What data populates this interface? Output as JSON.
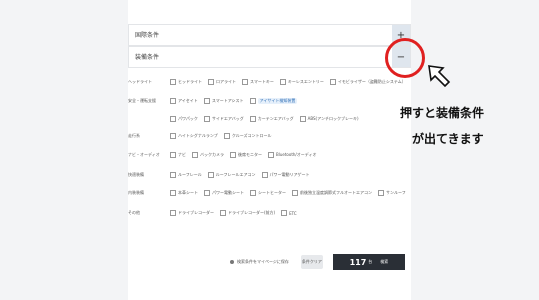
{
  "accordion": {
    "section1_label": "国際条件",
    "section1_btn": "+",
    "section2_label": "装備条件",
    "section2_btn": "−"
  },
  "rows": [
    {
      "label": "ヘッドライト",
      "options": [
        "ヒッドライト",
        "ロアライト",
        "スマートキー",
        "キーレスエントリー",
        "イモビライザー（盗難防止システム）"
      ]
    },
    {
      "label": "安全・運転支援",
      "options": [
        "アイセイト",
        "スマートアシスト",
        "アイサイト検知装置"
      ]
    },
    {
      "label": "",
      "options": [
        "パワパック",
        "サイドエアバッグ",
        "カーテンエアバッグ",
        "ABS(アンチロックブレーキ)"
      ]
    },
    {
      "label": "走行系",
      "options": [
        "ハイトシグナルランプ",
        "クルーズコントロール"
      ]
    },
    {
      "label": "ナビ・オーディオ",
      "options": [
        "ナビ",
        "バックカメラ",
        "後席モニター",
        "Bluetooth/オーディオ"
      ]
    },
    {
      "label": "快適装備",
      "options": [
        "ルーフレール",
        "ルーフレールエアコン",
        "パワー電動リアゲート"
      ]
    },
    {
      "label": "内装装備",
      "options": [
        "本革シート",
        "パワー電動シート",
        "シートヒーター",
        "前後独立温度調節式フルオートエアコン",
        "サンルーフ"
      ]
    },
    {
      "label": "その他",
      "options": [
        "ドライブレコーダー",
        "ドライブレコーダー(前方)",
        "ETC"
      ]
    }
  ],
  "footer": {
    "info_text": "検索条件をマイページに保存",
    "clear_label": "条件クリア",
    "count": "117",
    "unit": "台",
    "search_label": "検索"
  },
  "annotation": {
    "line1": "押すと装備条件",
    "line2": "が出てきます",
    "circle_color": "#e02020"
  }
}
